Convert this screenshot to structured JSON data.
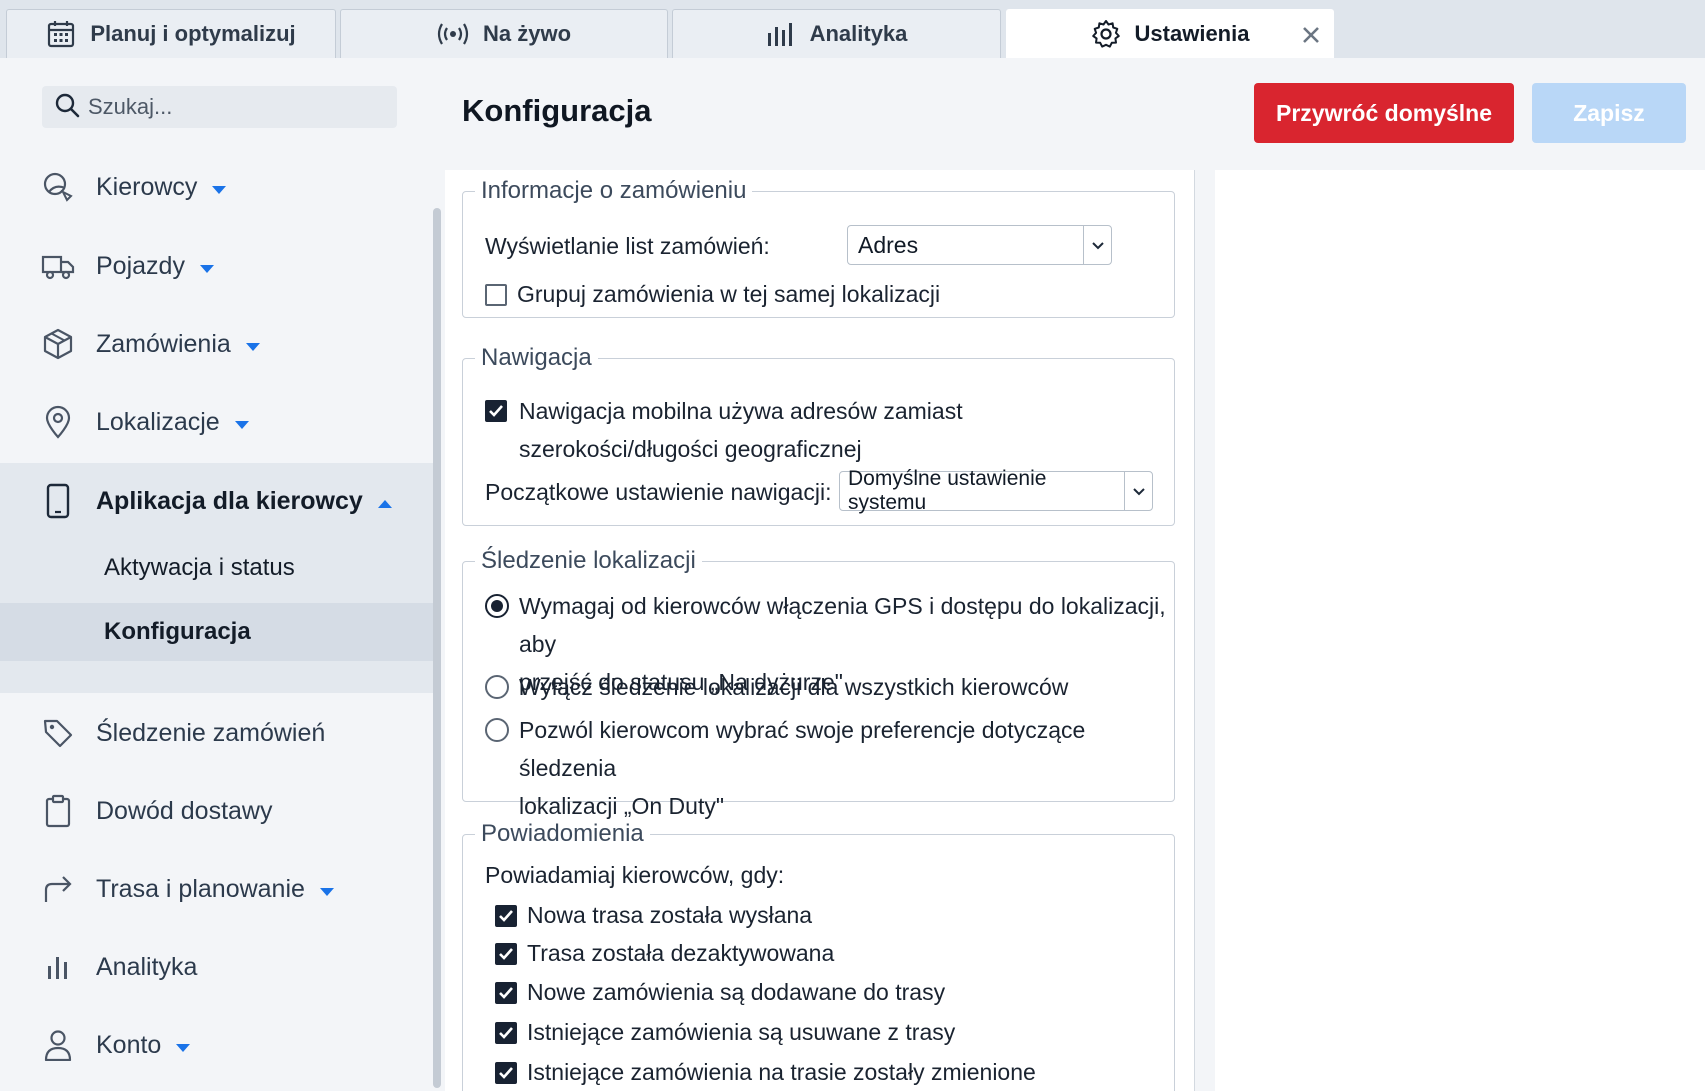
{
  "tabs": [
    {
      "label": "Planuj i optymalizuj",
      "icon": "calendar-icon"
    },
    {
      "label": "Na żywo",
      "icon": "live-signal-icon"
    },
    {
      "label": "Analityka",
      "icon": "bar-chart-icon"
    },
    {
      "label": "Ustawienia",
      "icon": "gear-icon",
      "active": true
    }
  ],
  "search": {
    "placeholder": "Szukaj..."
  },
  "sidebar": {
    "items": [
      {
        "label": "Kierowcy",
        "icon": "driver-icon",
        "caret": "down"
      },
      {
        "label": "Pojazdy",
        "icon": "truck-icon",
        "caret": "down"
      },
      {
        "label": "Zamówienia",
        "icon": "package-icon",
        "caret": "down"
      },
      {
        "label": "Lokalizacje",
        "icon": "location-pin-icon",
        "caret": "down"
      },
      {
        "label": "Aplikacja dla kierowcy",
        "icon": "phone-icon",
        "caret": "up",
        "expanded": true
      },
      {
        "label": "Śledzenie zamówień",
        "icon": "tag-icon"
      },
      {
        "label": "Dowód dostawy",
        "icon": "clipboard-icon"
      },
      {
        "label": "Trasa i planowanie",
        "icon": "route-arrow-icon",
        "caret": "down"
      },
      {
        "label": "Analityka",
        "icon": "analytics-icon"
      },
      {
        "label": "Konto",
        "icon": "user-icon",
        "caret": "down"
      }
    ],
    "subitems": [
      {
        "label": "Aktywacja i status"
      },
      {
        "label": "Konfiguracja",
        "selected": true
      }
    ]
  },
  "main": {
    "title": "Konfiguracja",
    "reset_label": "Przywróć domyślne",
    "save_label": "Zapisz"
  },
  "sections": {
    "order_info": {
      "legend": "Informacje o zamówieniu",
      "list_display_label": "Wyświetlanie list zamówień:",
      "list_display_value": "Adres",
      "group_label": "Grupuj zamówienia w tej samej lokalizacji",
      "group_checked": false
    },
    "navigation": {
      "legend": "Nawigacja",
      "mobile_nav_label_line1": "Nawigacja mobilna używa adresów zamiast",
      "mobile_nav_label_line2": "szerokości/długości geograficznej",
      "mobile_nav_checked": true,
      "initial_nav_label": "Początkowe ustawienie nawigacji:",
      "initial_nav_value": "Domyślne ustawienie systemu"
    },
    "location_tracking": {
      "legend": "Śledzenie lokalizacji",
      "options": [
        {
          "line1": "Wymagaj od kierowców włączenia GPS i dostępu do lokalizacji, aby",
          "line2": "przejść do statusu „Na dyżurze\"",
          "checked": true
        },
        {
          "line1": "Wyłącz śledzenie lokalizacji dla wszystkich kierowców",
          "line2": "",
          "checked": false
        },
        {
          "line1": "Pozwól kierowcom wybrać swoje preferencje dotyczące śledzenia",
          "line2": "lokalizacji „On Duty\"",
          "checked": false
        }
      ]
    },
    "notifications": {
      "legend": "Powiadomienia",
      "intro": "Powiadamiaj kierowców, gdy:",
      "options": [
        {
          "label": "Nowa trasa została wysłana",
          "checked": true
        },
        {
          "label": "Trasa została dezaktywowana",
          "checked": true
        },
        {
          "label": "Nowe zamówienia są dodawane do trasy",
          "checked": true
        },
        {
          "label": "Istniejące zamówienia są usuwane z trasy",
          "checked": true
        },
        {
          "label": "Istniejące zamówienia na trasie zostały zmienione",
          "checked": true
        }
      ]
    }
  },
  "colors": {
    "accent_red": "#d9252f",
    "disabled_blue": "#b9d7f7",
    "caret_blue": "#1a73e8"
  }
}
